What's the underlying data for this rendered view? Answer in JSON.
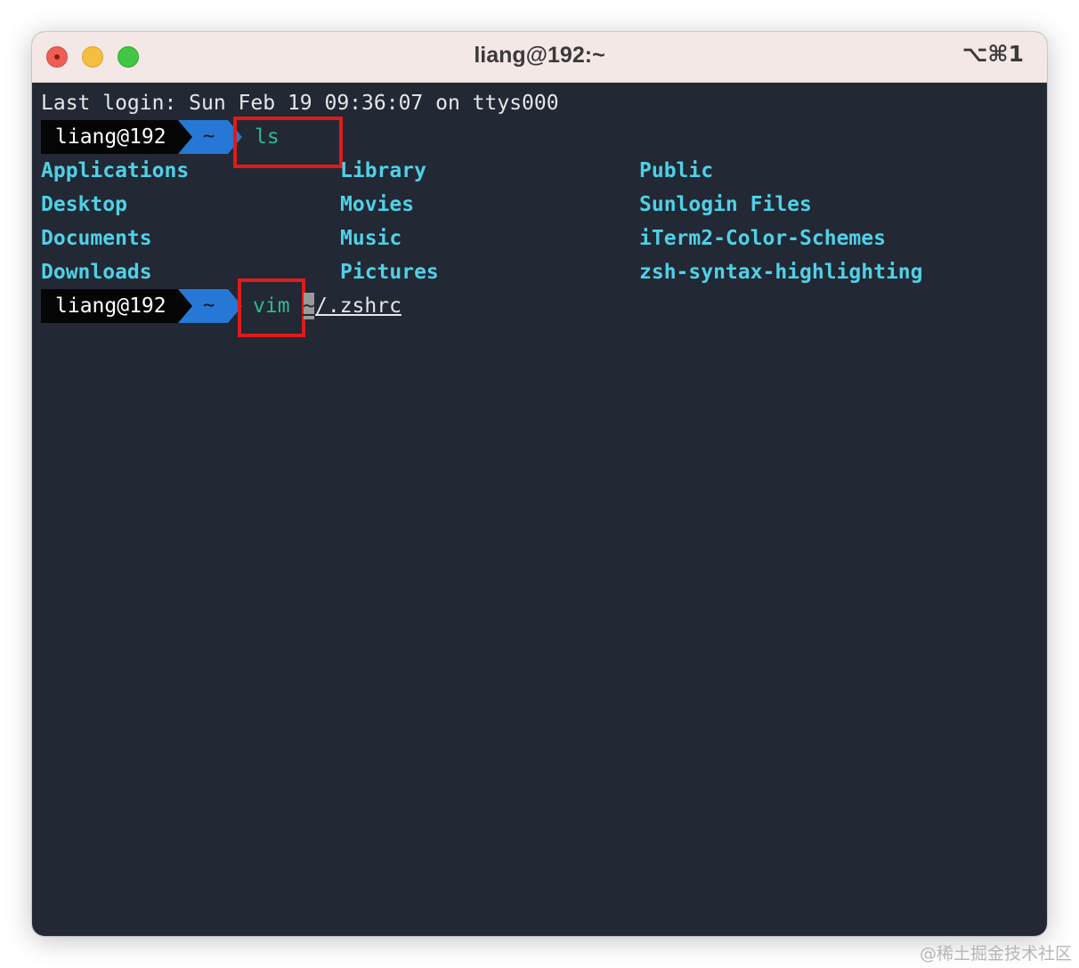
{
  "window": {
    "title": "liang@192:~",
    "shortcut": "⌥⌘1"
  },
  "terminal": {
    "last_login": "Last login: Sun Feb 19 09:36:07 on ttys000",
    "prompt_user": "liang@192",
    "prompt_dir": "~",
    "command1": "ls",
    "ls_output": [
      [
        "Applications",
        "Library",
        "Public"
      ],
      [
        "Desktop",
        "Movies",
        "Sunlogin Files"
      ],
      [
        "Documents",
        "Music",
        "iTerm2-Color-Schemes"
      ],
      [
        "Downloads",
        "Pictures",
        "zsh-syntax-highlighting"
      ]
    ],
    "command2": "vim",
    "command2_arg_cursor_char": "~",
    "command2_arg_rest": "/.zshrc"
  },
  "watermark": "@稀土掘金技术社区",
  "colors": {
    "prompt_user_bg": "#050505",
    "prompt_dir_bg": "#2777d6",
    "command_color": "#2fb98b",
    "directory_color": "#4fd1e6",
    "highlight_box": "#e11a1a",
    "terminal_bg": "#222834",
    "titlebar_bg": "#f4e8e6"
  }
}
